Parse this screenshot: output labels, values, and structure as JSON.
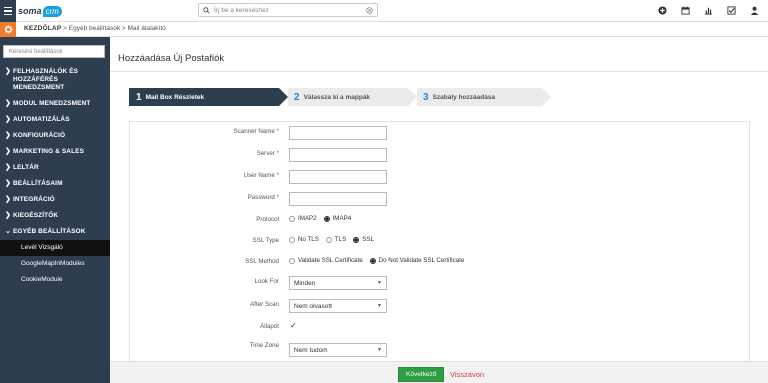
{
  "topbar": {
    "logo_text": "soma",
    "logo_badge": "crm",
    "search_placeholder": "Írj be a kereséshez",
    "icons": [
      "plus-icon",
      "calendar-icon",
      "bar-chart-icon",
      "checklist-icon",
      "user-icon"
    ]
  },
  "breadcrumb": {
    "home": "KEZDŐLAP",
    "trail": " > Egyéb beállítások > Mail átalakító"
  },
  "sidebar": {
    "search_placeholder": "Keresési beállítások",
    "items": [
      {
        "label": "FELHASZNÁLÓK ÉS HOZZÁFÉRÉS MENEDZSMENT"
      },
      {
        "label": "MODUL MENEDZSMENT"
      },
      {
        "label": "AUTOMATIZÁLÁS"
      },
      {
        "label": "KONFIGURÁCIÓ"
      },
      {
        "label": "MARKETING & SALES"
      },
      {
        "label": "LELTÁR"
      },
      {
        "label": "BEÁLLÍTÁSAIM"
      },
      {
        "label": "INTEGRÁCIÓ"
      },
      {
        "label": "KIEGÉSZÍTŐK"
      },
      {
        "label": "EGYÉB BEÁLLÍTÁSOK"
      }
    ],
    "subitems": [
      {
        "label": "Levél Vizsgáló",
        "active": true
      },
      {
        "label": "GoogleMapInModules",
        "active": false
      },
      {
        "label": "CookieModule",
        "active": false
      }
    ]
  },
  "page": {
    "title": "Hozzáadása Új Postafiók"
  },
  "steps": [
    {
      "num": "1",
      "label": "Mail Box Részletek",
      "active": true
    },
    {
      "num": "2",
      "label": "Válassza ki a mappák",
      "active": false
    },
    {
      "num": "3",
      "label": "Szabály hozzáadása",
      "active": false
    }
  ],
  "form": {
    "scanner_name": {
      "label": "Scanner Name",
      "required": "*",
      "value": ""
    },
    "server": {
      "label": "Server",
      "required": "*",
      "value": ""
    },
    "user_name": {
      "label": "User Name",
      "required": "*",
      "value": ""
    },
    "password": {
      "label": "Password",
      "required": "*",
      "value": ""
    },
    "protocol": {
      "label": "Protocol",
      "options": [
        "IMAP2",
        "IMAP4"
      ],
      "selected": "IMAP4"
    },
    "ssl_type": {
      "label": "SSL Type",
      "options": [
        "No TLS",
        "TLS",
        "SSL"
      ],
      "selected": "SSL"
    },
    "ssl_method": {
      "label": "SSL Method",
      "options": [
        "Validate SSL Certificate",
        "Do Not Validate SSL Certificate"
      ],
      "selected": "Do Not Validate SSL Certificate"
    },
    "look_for": {
      "label": "Look For",
      "value": "Minden"
    },
    "after_scan": {
      "label": "After Scan",
      "value": "Nem olvasott"
    },
    "allapot": {
      "label": "Állapot",
      "checked": true
    },
    "time_zone": {
      "label": "Time Zone",
      "value": "Nem tudom"
    }
  },
  "footer": {
    "next_label": "Következő",
    "cancel_label": "Visszavon"
  },
  "colors": {
    "sidebar_bg": "#2d3e4f",
    "accent_orange": "#f07b2b",
    "next_green": "#2e9e44",
    "cancel_red": "#e53935",
    "step_number_blue": "#1e88e5"
  }
}
